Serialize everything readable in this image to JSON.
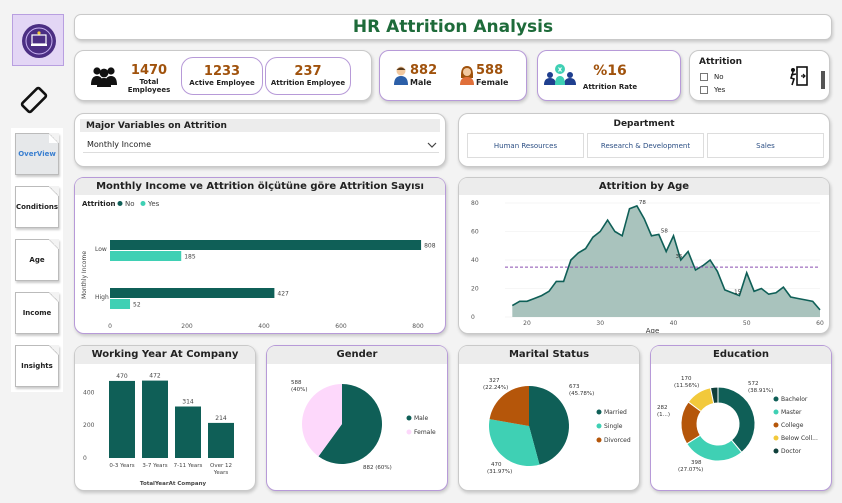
{
  "header": {
    "title": "HR Attrition Analysis"
  },
  "nav": {
    "tabs": [
      {
        "label": "OverView",
        "active": true
      },
      {
        "label": "Conditions"
      },
      {
        "label": "Age"
      },
      {
        "label": "Income"
      },
      {
        "label": "Insights"
      }
    ]
  },
  "kpi": {
    "total_employees": {
      "value": "1470",
      "label": "Total Employees"
    },
    "active_employee": {
      "value": "1233",
      "label": "Active Employee"
    },
    "attrition_employee": {
      "value": "237",
      "label": "Attrition Employee"
    },
    "male": {
      "value": "882",
      "label": "Male"
    },
    "female": {
      "value": "588",
      "label": "Female"
    },
    "attrition_rate": {
      "value": "%16",
      "label": "Attrition Rate"
    }
  },
  "attrition_filter": {
    "title": "Attrition",
    "options": [
      "No",
      "Yes"
    ]
  },
  "major_variables": {
    "title": "Major Variables on Attrition",
    "selected": "Monthly Income"
  },
  "department": {
    "title": "Department",
    "buttons": [
      "Human Resources",
      "Research & Development",
      "Sales"
    ]
  },
  "colors": {
    "no": "#0f5f57",
    "yes": "#3fd0b4",
    "divorced": "#b5560a",
    "female": "#fdd8fb",
    "college": "#b5560a",
    "below": "#f2c93b",
    "doctor": "#0f3f3a",
    "accent": "#1e6b3a"
  },
  "chart_data": [
    {
      "type": "bar",
      "orientation": "horizontal",
      "title": "Monthly Income ve Attrition ölçütüne göre Attrition Sayısı",
      "legend_title": "Attrition",
      "categories": [
        "Low",
        "High"
      ],
      "ylabel": "Monthly Income",
      "series": [
        {
          "name": "No",
          "values": [
            808,
            427
          ]
        },
        {
          "name": "Yes",
          "values": [
            185,
            52
          ]
        }
      ],
      "data_labels": [
        [
          "808",
          "427"
        ],
        [
          "185",
          "52"
        ]
      ],
      "x_ticks": [
        "0",
        "200",
        "400",
        "600",
        "800"
      ],
      "xlim": [
        0,
        800
      ]
    },
    {
      "type": "area",
      "title": "Attrition by Age",
      "xlabel": "Age",
      "x": [
        18,
        19,
        20,
        21,
        22,
        23,
        24,
        25,
        26,
        27,
        28,
        29,
        30,
        31,
        32,
        33,
        34,
        35,
        36,
        37,
        38,
        39,
        40,
        41,
        42,
        43,
        44,
        45,
        46,
        47,
        48,
        49,
        50,
        51,
        52,
        53,
        54,
        55,
        56,
        57,
        58,
        59,
        60
      ],
      "values": [
        8,
        11,
        11,
        13,
        15,
        18,
        25,
        25,
        40,
        45,
        48,
        56,
        60,
        68,
        60,
        57,
        76,
        78,
        69,
        57,
        58,
        46,
        57,
        40,
        46,
        33,
        36,
        40,
        32,
        19,
        17,
        15,
        31,
        18,
        20,
        16,
        17,
        21,
        14,
        13,
        12,
        11,
        5
      ],
      "data_labels": [
        "78",
        "58",
        "35",
        "15"
      ],
      "x_ticks": [
        "20",
        "30",
        "40",
        "50",
        "60"
      ],
      "y_ticks": [
        "0",
        "20",
        "40",
        "60",
        "80"
      ],
      "xlim": [
        17,
        60
      ],
      "ylim": [
        0,
        80
      ],
      "average_line": 35
    },
    {
      "type": "bar",
      "title": "Working Year At Company",
      "xlabel": "TotalYearAt Company",
      "categories": [
        "0-3 Years",
        "3-7 Years",
        "7-11 Years",
        "Over 12 Years"
      ],
      "category_lines": [
        [
          "0-3 Years"
        ],
        [
          "3-7 Years"
        ],
        [
          "7-11 Years"
        ],
        [
          "Over 12",
          "Years"
        ]
      ],
      "values": [
        470,
        472,
        314,
        214
      ],
      "y_ticks": [
        "0",
        "200",
        "400"
      ],
      "ylim": [
        0,
        500
      ]
    },
    {
      "type": "pie",
      "title": "Gender",
      "labels": [
        "Male",
        "Female"
      ],
      "values": [
        882,
        588
      ],
      "slice_labels": [
        "882 (60%)",
        "588 (40%)"
      ]
    },
    {
      "type": "pie",
      "title": "Marital Status",
      "labels": [
        "Married",
        "Single",
        "Divorced"
      ],
      "values": [
        673,
        470,
        327
      ],
      "slice_labels": [
        "673 (45.78%)",
        "470 (31.97%)",
        "327 (22.24%)"
      ]
    },
    {
      "type": "pie",
      "donut": true,
      "title": "Education",
      "labels": [
        "Bachelor",
        "Master",
        "College",
        "Below Coll...",
        "Doctor"
      ],
      "values": [
        572,
        398,
        282,
        170,
        48
      ],
      "slice_labels": [
        "572 (38.91%)",
        "398 (27.07%)",
        "282 (1...)",
        "170 (11.56%)",
        ""
      ]
    }
  ]
}
